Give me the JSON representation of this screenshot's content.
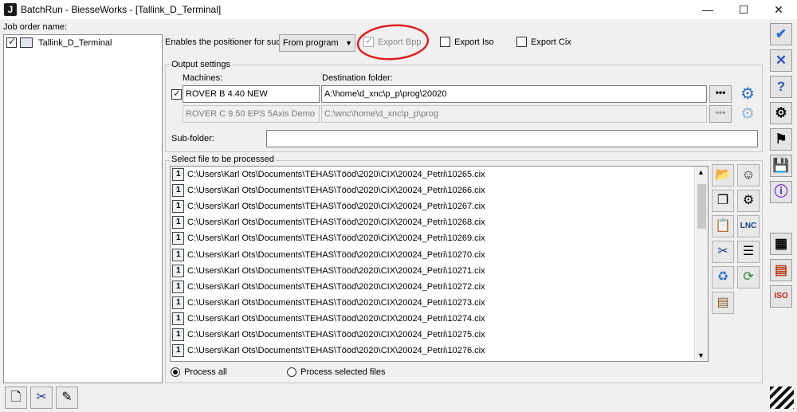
{
  "window": {
    "title": "BatchRun - BiesseWorks - [Tallink_D_Terminal]",
    "minimize": "—",
    "maximize": "☐",
    "close": "✕"
  },
  "left": {
    "job_label": "Job order name:",
    "jobs": [
      {
        "name": "Tallink_D_Terminal",
        "checked": true
      }
    ]
  },
  "top_options": {
    "positioner_label": "Enables the positioner for suctio",
    "positioner_value": "From program",
    "export_bpp": "Export Bpp",
    "export_iso": "Export Iso",
    "export_cix": "Export Cix"
  },
  "output": {
    "group_label": "Output settings",
    "machines_header": "Machines:",
    "dest_header": "Destination folder:",
    "machines": [
      {
        "name": "ROVER B 4.40 NEW",
        "folder": "A:\\home\\d_xnc\\p_p\\prog\\20020",
        "checked": true,
        "enabled": true
      },
      {
        "name": "ROVER C 9.50 EPS 5Axis Demo",
        "folder": "C:\\wnc\\home\\d_xnc\\p_p\\prog",
        "checked": false,
        "enabled": false
      }
    ],
    "dots": "•••",
    "subfolder_label": "Sub-folder:",
    "subfolder_value": ""
  },
  "files": {
    "group_label": "Select file to be processed",
    "items": [
      "C:\\Users\\Karl Ots\\Documents\\TEHAS\\Tööd\\2020\\CIX\\20024_Petri\\10265.cix",
      "C:\\Users\\Karl Ots\\Documents\\TEHAS\\Tööd\\2020\\CIX\\20024_Petri\\10266.cix",
      "C:\\Users\\Karl Ots\\Documents\\TEHAS\\Tööd\\2020\\CIX\\20024_Petri\\10267.cix",
      "C:\\Users\\Karl Ots\\Documents\\TEHAS\\Tööd\\2020\\CIX\\20024_Petri\\10268.cix",
      "C:\\Users\\Karl Ots\\Documents\\TEHAS\\Tööd\\2020\\CIX\\20024_Petri\\10269.cix",
      "C:\\Users\\Karl Ots\\Documents\\TEHAS\\Tööd\\2020\\CIX\\20024_Petri\\10270.cix",
      "C:\\Users\\Karl Ots\\Documents\\TEHAS\\Tööd\\2020\\CIX\\20024_Petri\\10271.cix",
      "C:\\Users\\Karl Ots\\Documents\\TEHAS\\Tööd\\2020\\CIX\\20024_Petri\\10272.cix",
      "C:\\Users\\Karl Ots\\Documents\\TEHAS\\Tööd\\2020\\CIX\\20024_Petri\\10273.cix",
      "C:\\Users\\Karl Ots\\Documents\\TEHAS\\Tööd\\2020\\CIX\\20024_Petri\\10274.cix",
      "C:\\Users\\Karl Ots\\Documents\\TEHAS\\Tööd\\2020\\CIX\\20024_Petri\\10275.cix",
      "C:\\Users\\Karl Ots\\Documents\\TEHAS\\Tööd\\2020\\CIX\\20024_Petri\\10276.cix"
    ],
    "process_all": "Process all",
    "process_selected": "Process selected files"
  },
  "side_icons": [
    "check-icon",
    "cancel-icon",
    "help-icon",
    "setup-icon",
    "checkered-flag-icon",
    "save-icon",
    "info-icon",
    "list-icon",
    "iso-icon"
  ],
  "file_tool_icons": [
    "open-folder-icon",
    "smiley-icon",
    "copy-icon",
    "cogwheel-icon",
    "paste-icon",
    "lnc-icon",
    "scissors-icon",
    "edit-list-icon",
    "recycle-bin-icon",
    "refresh-icon",
    "stack-icon"
  ],
  "side_labels": {
    "iso": "ISO",
    "lnc": "LNC"
  },
  "colors": {
    "accent_blue": "#2a6fc0",
    "annotation_red": "#e02020",
    "check_blue": "#2d6fd1",
    "cancel_blue": "#2d57b8"
  }
}
